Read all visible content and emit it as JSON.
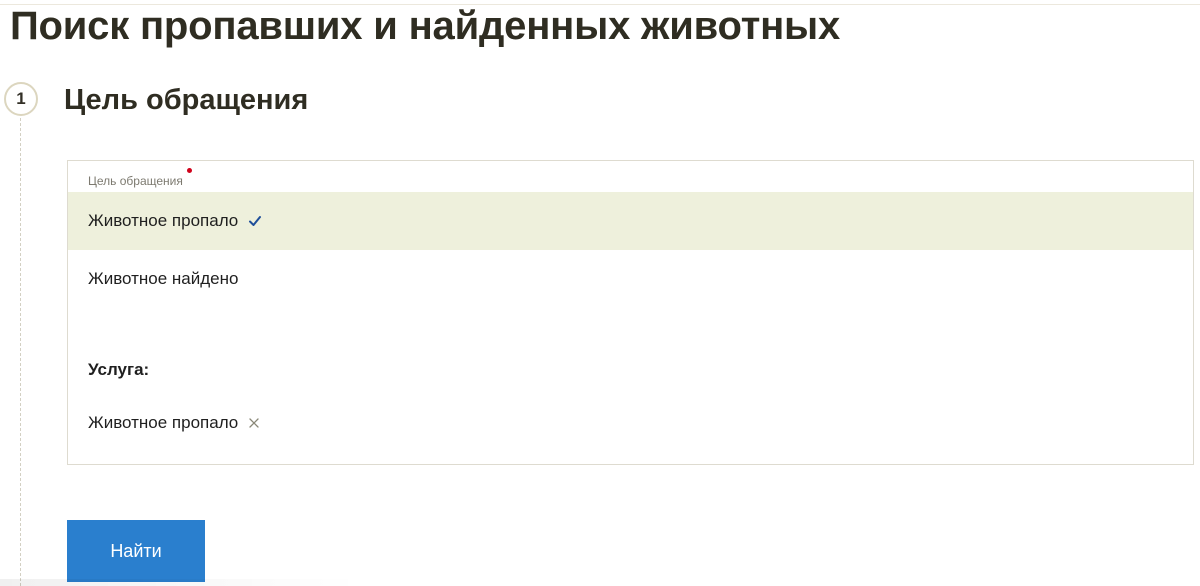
{
  "page": {
    "title": "Поиск пропавших и найденных животных"
  },
  "step": {
    "number": "1",
    "title": "Цель обращения"
  },
  "purpose_select": {
    "label": "Цель обращения",
    "required": true,
    "options": [
      {
        "label": "Животное пропало",
        "selected": true
      },
      {
        "label": "Животное найдено",
        "selected": false
      }
    ]
  },
  "service": {
    "heading": "Услуга:",
    "selected_tag": "Животное пропало"
  },
  "actions": {
    "submit_label": "Найти"
  },
  "colors": {
    "accent_button": "#2a7fce",
    "selected_row": "#eef0dc",
    "check_mark": "#1f4f9a",
    "required_dot": "#d0021b"
  },
  "icons": {
    "check": "check-icon",
    "remove": "close-icon"
  }
}
